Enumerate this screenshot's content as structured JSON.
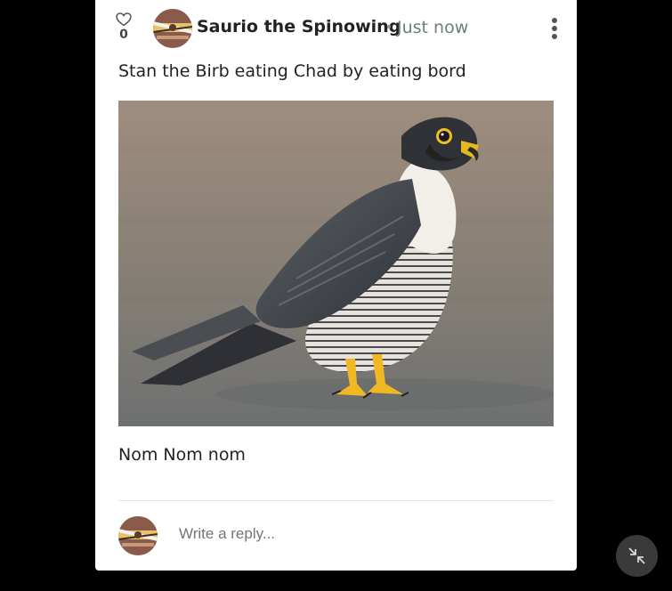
{
  "post": {
    "like_count": "0",
    "author": "Saurio the Spinowing",
    "timestamp": "Just now",
    "text": "Stan the Birb eating Chad by eating bord",
    "caption": "Nom Nom nom",
    "image_subject": "peregrine falcon standing on wet sand"
  },
  "reply": {
    "placeholder": "Write a reply..."
  },
  "icons": {
    "like": "heart-icon",
    "menu": "more-vertical-icon",
    "fab": "minimize-icon"
  },
  "colors": {
    "meta": "#6b8078",
    "page_background": "#000000",
    "card_background": "#ffffff",
    "fab_background": "#3a3a3a"
  }
}
